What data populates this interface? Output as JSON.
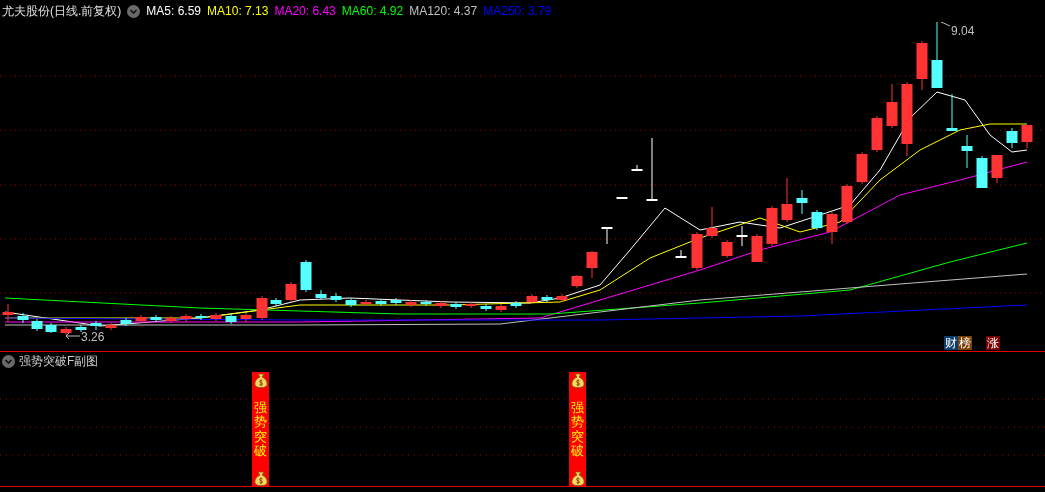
{
  "title": "尤夫股份(日线.前复权)",
  "indicators": [
    {
      "label": "MA5: 6.59",
      "color": "#ffffff"
    },
    {
      "label": "MA10: 7.13",
      "color": "#ffff00"
    },
    {
      "label": "MA20: 6.43",
      "color": "#ff00ff"
    },
    {
      "label": "MA60: 4.92",
      "color": "#00ff00"
    },
    {
      "label": "MA120: 4.37",
      "color": "#c0c0c0"
    },
    {
      "label": "MA250: 3.79",
      "color": "#0000ff"
    }
  ],
  "chart": {
    "high_label": "9.04",
    "low_label": "3.26",
    "badges": [
      {
        "text": "财",
        "color": "#0c3c6c"
      },
      {
        "text": "榜",
        "color": "#7a4206"
      },
      {
        "text": "涨",
        "color": "#7a0000"
      }
    ]
  },
  "sub_panel": {
    "title": "强势突破F副图",
    "signals": [
      {
        "text": "强势突破"
      },
      {
        "text": "强势突破"
      }
    ]
  }
}
